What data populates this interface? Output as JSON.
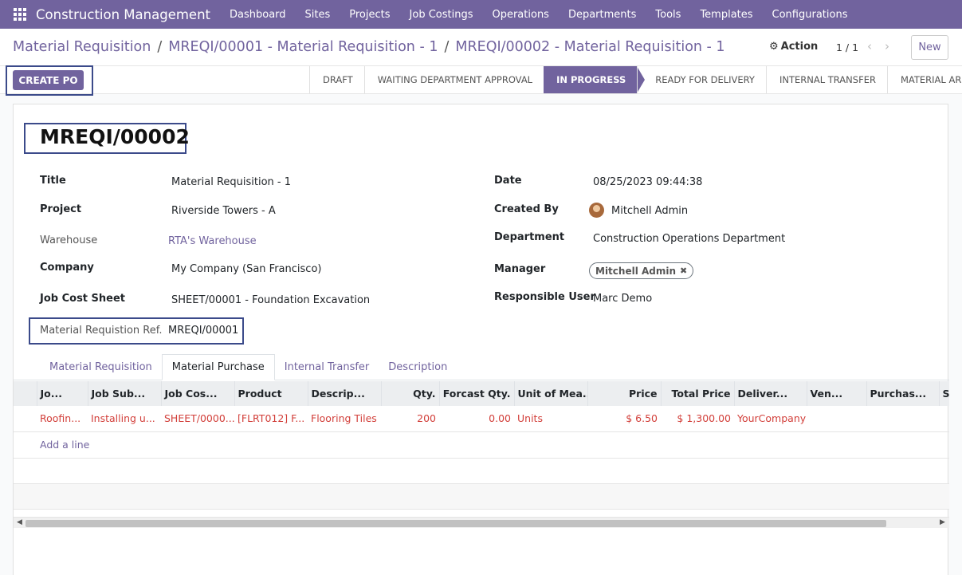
{
  "navbar": {
    "app_title": "Construction Management",
    "menu": [
      "Dashboard",
      "Sites",
      "Projects",
      "Job Costings",
      "Operations",
      "Departments",
      "Tools",
      "Templates",
      "Configurations"
    ]
  },
  "breadcrumb": {
    "items": [
      "Material Requisition",
      "MREQI/00001 - Material Requisition - 1",
      "MREQI/00002 - Material Requisition - 1"
    ],
    "separator": "/"
  },
  "control": {
    "action_label": "Action",
    "pager": "1 / 1",
    "new_label": "New"
  },
  "statusbar": {
    "create_po_label": "CREATE PO",
    "stages": [
      "DRAFT",
      "WAITING DEPARTMENT APPROVAL",
      "IN PROGRESS",
      "READY FOR DELIVERY",
      "INTERNAL TRANSFER",
      "MATERIAL ARRIVED"
    ],
    "active_stage": "IN PROGRESS"
  },
  "form": {
    "reference": "MREQI/00002",
    "left": {
      "title_label": "Title",
      "title_value": "Material Requisition - 1",
      "project_label": "Project",
      "project_value": "Riverside Towers - A",
      "warehouse_label": "Warehouse",
      "warehouse_value": "RTA's Warehouse",
      "company_label": "Company",
      "company_value": "My Company (San Francisco)",
      "job_cost_sheet_label": "Job Cost Sheet",
      "job_cost_sheet_value": "SHEET/00001 - Foundation Excavation",
      "mreq_ref_label": "Material Requistion Ref.",
      "mreq_ref_value": "MREQI/00001"
    },
    "right": {
      "date_label": "Date",
      "date_value": "08/25/2023 09:44:38",
      "created_by_label": "Created By",
      "created_by_value": "Mitchell Admin",
      "department_label": "Department",
      "department_value": "Construction Operations Department",
      "manager_label": "Manager",
      "manager_tag": "Mitchell Admin",
      "responsible_label": "Responsible User",
      "responsible_value": "Marc Demo"
    }
  },
  "tabs": [
    "Material Requisition",
    "Material Purchase",
    "Internal Transfer",
    "Description"
  ],
  "active_tab": "Material Purchase",
  "table": {
    "columns": [
      "Jo...",
      "Job Sub...",
      "Job Cos...",
      "Product",
      "Descrip...",
      "Qty.",
      "Forcast Qty.",
      "Unit of Mea...",
      "Price",
      "Total Price",
      "Deliver...",
      "Ven...",
      "Purchas...",
      "S"
    ],
    "rows": [
      [
        "Roofin...",
        "Installing u...",
        "SHEET/0000...",
        "[FLRT012] F...",
        "Flooring Tiles",
        "200",
        "0.00",
        "Units",
        "$ 6.50",
        "$ 1,300.00",
        "YourCompany",
        "",
        "",
        ""
      ]
    ],
    "add_line_label": "Add a line"
  },
  "colors": {
    "brand": "#71639e",
    "highlight_frame": "#3b4a8a",
    "line_text": "#d23f3a"
  }
}
